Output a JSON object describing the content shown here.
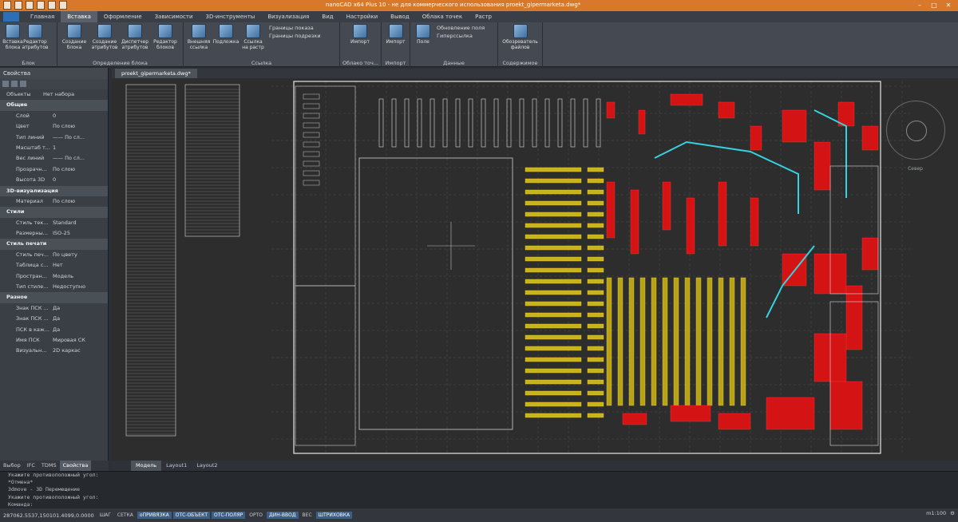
{
  "window": {
    "title": "nanoCAD x64 Plus 10 - не для коммерческого использования proekt_gipermarketa.dwg*"
  },
  "ribbon_tabs": [
    "Главная",
    "Вставка",
    "Оформление",
    "Зависимости",
    "3D-инструменты",
    "Визуализация",
    "Вид",
    "Настройки",
    "Вывод",
    "Облака точек",
    "Растр"
  ],
  "active_tab": "Вставка",
  "ribbon": {
    "blocks": {
      "insert_block": "Вставка блока",
      "block_editor": "Редактор атрибутов",
      "label": "Блок"
    },
    "block_def": {
      "create_block": "Создание блока",
      "create_attr": "Создание атрибутов",
      "attr_manager": "Диспетчер атрибутов",
      "block_editor": "Редактор блоков",
      "label": "Определение блока"
    },
    "reference": {
      "external_ref": "Внешняя ссылка",
      "underlay": "Подложка",
      "raster_link": "Ссылка на растр",
      "show_bounds": "Границы показа",
      "clip_bounds": "Границы подрезки",
      "label": "Ссылка"
    },
    "pointcloud": {
      "import": "Импорт",
      "label": "Облако точ..."
    },
    "import": {
      "import": "Импорт",
      "label": "Импорт"
    },
    "data": {
      "field": "Поле",
      "update_field": "Обновление поля",
      "hyperlink": "Гиперссылка",
      "label": "Данные"
    },
    "content": {
      "file_browser": "Обозреватель файлов",
      "label": "Содержимое"
    }
  },
  "properties_panel": {
    "title": "Свойства",
    "objects_label": "Объекты",
    "objects_value": "Нет набора",
    "sections": [
      {
        "name": "Общие",
        "rows": [
          {
            "k": "Слой",
            "v": "0"
          },
          {
            "k": "Цвет",
            "v": "По слою"
          },
          {
            "k": "Тип линий",
            "v": "—— По сл..."
          },
          {
            "k": "Масштаб т...",
            "v": "1"
          },
          {
            "k": "Вес линий",
            "v": "—— По сл..."
          },
          {
            "k": "Прозрачн...",
            "v": "По слою"
          },
          {
            "k": "Высота 3D",
            "v": "0"
          }
        ]
      },
      {
        "name": "3D-визуализация",
        "rows": [
          {
            "k": "Материал",
            "v": "По слою"
          }
        ]
      },
      {
        "name": "Стили",
        "rows": [
          {
            "k": "Стиль тек...",
            "v": "Standard"
          },
          {
            "k": "Размерны...",
            "v": "ISO-25"
          }
        ]
      },
      {
        "name": "Стиль печати",
        "rows": [
          {
            "k": "Стиль печ...",
            "v": "По цвету"
          },
          {
            "k": "Таблица с...",
            "v": "Нет"
          },
          {
            "k": "Простран...",
            "v": "Модель"
          },
          {
            "k": "Тип стиле...",
            "v": "Недоступно"
          }
        ]
      },
      {
        "name": "Разное",
        "rows": [
          {
            "k": "Знак ПСК ...",
            "v": "Да"
          },
          {
            "k": "Знак ПСК ...",
            "v": "Да"
          },
          {
            "k": "ПСК в каж...",
            "v": "Да"
          },
          {
            "k": "Имя ПСК",
            "v": "Мировая СК"
          },
          {
            "k": "Визуальн...",
            "v": "2D каркас"
          }
        ]
      }
    ],
    "bottom_tabs": [
      "Выбор",
      "IFC",
      "TDMS",
      "Свойства"
    ],
    "active_bottom_tab": "Свойства"
  },
  "document_tab": "proekt_gipermarketa.dwg*",
  "layout_tabs": [
    "Модель",
    "Layout1",
    "Layout2"
  ],
  "active_layout": "Модель",
  "viewcube_label": "Север",
  "command_lines": [
    "Укажите противоположный угол:",
    "*Отмена*",
    "3dmove - 3D Перемещение",
    "Укажите противоположный угол:",
    "Команда:"
  ],
  "status": {
    "coords": "287062.5537,150101.4099,0.0000",
    "buttons": [
      {
        "label": "ШАГ",
        "on": false
      },
      {
        "label": "СЕТКА",
        "on": false
      },
      {
        "label": "оПРИВЯЗКА",
        "on": true
      },
      {
        "label": "ОТС-ОБЪЕКТ",
        "on": true
      },
      {
        "label": "ОТС-ПОЛЯР",
        "on": true
      },
      {
        "label": "ОРТО",
        "on": false
      },
      {
        "label": "ДИН-ВВОД",
        "on": true
      },
      {
        "label": "ВЕС",
        "on": false
      },
      {
        "label": "ШТРИХОВКА",
        "on": true
      }
    ],
    "scale": "m1:100"
  },
  "colors": {
    "titlebar": "#d8782a",
    "canvas": "#2d2d2d",
    "accent_on": "#3c5f88"
  }
}
